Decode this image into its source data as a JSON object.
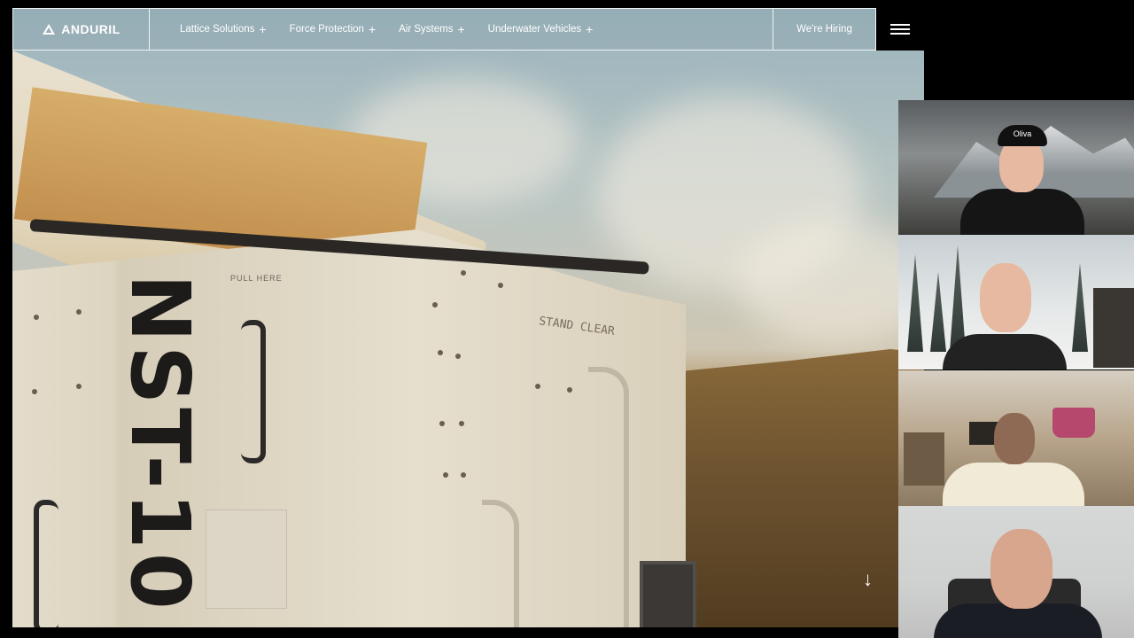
{
  "site": {
    "brand": "ANDURIL",
    "nav_links": [
      {
        "label": "Lattice Solutions",
        "expand": "+"
      },
      {
        "label": "Force Protection",
        "expand": "+"
      },
      {
        "label": "Air Systems",
        "expand": "+"
      },
      {
        "label": "Underwater Vehicles",
        "expand": "+"
      }
    ],
    "hiring_label": "We're Hiring",
    "hero": {
      "crate_label": "NST-10",
      "pull_here": "PULL HERE",
      "stand_clear": "STAND CLEAR"
    },
    "scroll_arrow": "↓"
  },
  "participants": [
    {
      "name": "participant-1",
      "cap_text": "Oliva"
    },
    {
      "name": "participant-2"
    },
    {
      "name": "participant-3"
    },
    {
      "name": "participant-4"
    }
  ],
  "colors": {
    "nav_border": "#ffffff",
    "background": "#000000",
    "crate": "#e4dccb"
  }
}
